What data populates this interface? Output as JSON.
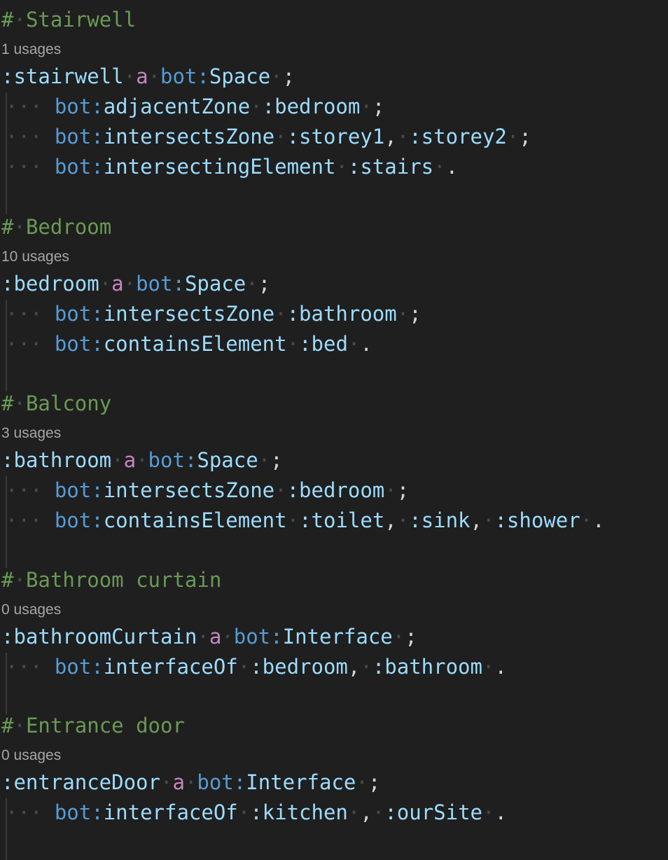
{
  "editor": {
    "lang": "turtle",
    "blocks": [
      {
        "heading": "Stairwell",
        "usages": "1 usages",
        "subject": ":stairwell",
        "type": "Space",
        "props": [
          {
            "pred": "adjacentZone",
            "objs": [
              ":bedroom"
            ],
            "sep": ", ",
            "end": ";"
          },
          {
            "pred": "intersectsZone",
            "objs": [
              ":storey1",
              ":storey2"
            ],
            "sep": ", ",
            "end": ";"
          },
          {
            "pred": "intersectingElement",
            "objs": [
              ":stairs"
            ],
            "sep": ", ",
            "end": "."
          }
        ]
      },
      {
        "heading": "Bedroom",
        "usages": "10 usages",
        "subject": ":bedroom",
        "type": "Space",
        "props": [
          {
            "pred": "intersectsZone",
            "objs": [
              ":bathroom"
            ],
            "sep": ", ",
            "end": ";"
          },
          {
            "pred": "containsElement",
            "objs": [
              ":bed"
            ],
            "sep": ", ",
            "end": "."
          }
        ]
      },
      {
        "heading": "Balcony",
        "usages": "3 usages",
        "subject": ":bathroom",
        "type": "Space",
        "props": [
          {
            "pred": "intersectsZone",
            "objs": [
              ":bedroom"
            ],
            "sep": ", ",
            "end": ";"
          },
          {
            "pred": "containsElement",
            "objs": [
              ":toilet",
              ":sink",
              ":shower"
            ],
            "sep": ", ",
            "end": "."
          }
        ]
      },
      {
        "heading": "Bathroom curtain",
        "usages": "0 usages",
        "subject": ":bathroomCurtain",
        "type": "Interface",
        "props": [
          {
            "pred": "interfaceOf",
            "objs": [
              ":bedroom",
              ":bathroom"
            ],
            "sep": ", ",
            "end": "."
          }
        ]
      },
      {
        "heading": "Entrance door",
        "usages": "0 usages",
        "subject": ":entranceDoor",
        "type": "Interface",
        "props": [
          {
            "pred": "interfaceOf",
            "objs": [
              ":kitchen",
              ":ourSite"
            ],
            "sep": " , ",
            "end": "."
          }
        ]
      }
    ],
    "tokens": {
      "comment_marker": "#",
      "type_keyword": "a",
      "prefix": "bot:",
      "ws_dot": "·"
    }
  }
}
